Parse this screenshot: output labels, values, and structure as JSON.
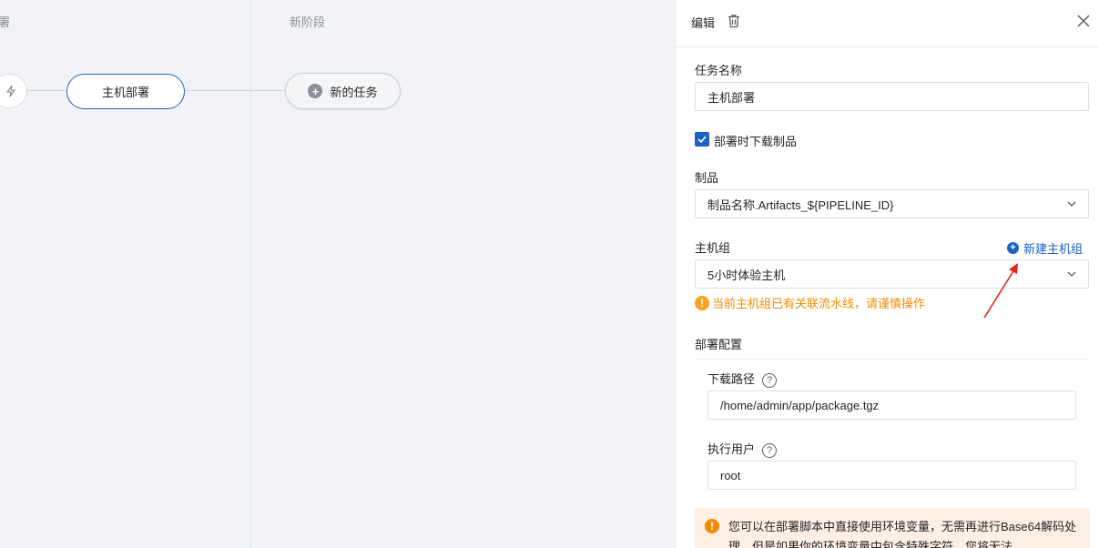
{
  "canvas": {
    "stages": [
      {
        "title": "署"
      },
      {
        "title": "新阶段"
      }
    ],
    "task_node": {
      "label": "主机部署"
    },
    "new_task_button": {
      "label": "新的任务"
    }
  },
  "panel": {
    "title": "编辑",
    "task_name": {
      "label": "任务名称",
      "value": "主机部署"
    },
    "download_artifact": {
      "label": "部署时下载制品",
      "checked": true
    },
    "artifact": {
      "label": "制品",
      "value": "制品名称.Artifacts_${PIPELINE_ID}"
    },
    "host_group": {
      "label": "主机组",
      "value": "5小时体验主机",
      "new_link": "新建主机组",
      "warning": "当前主机组已有关联流水线，请谨慎操作"
    },
    "deploy_config": {
      "title": "部署配置",
      "download_path": {
        "label": "下载路径",
        "value": "/home/admin/app/package.tgz"
      },
      "exec_user": {
        "label": "执行用户",
        "value": "root"
      }
    },
    "info": {
      "text": "您可以在部署脚本中直接使用环境变量，无需再进行Base64解码处理。但是如果你的环境变量中包含特殊字符，您将无法"
    }
  },
  "colors": {
    "primary": "#1b62c4",
    "warning": "#f08c00",
    "info_bg": "#fdefe4"
  }
}
